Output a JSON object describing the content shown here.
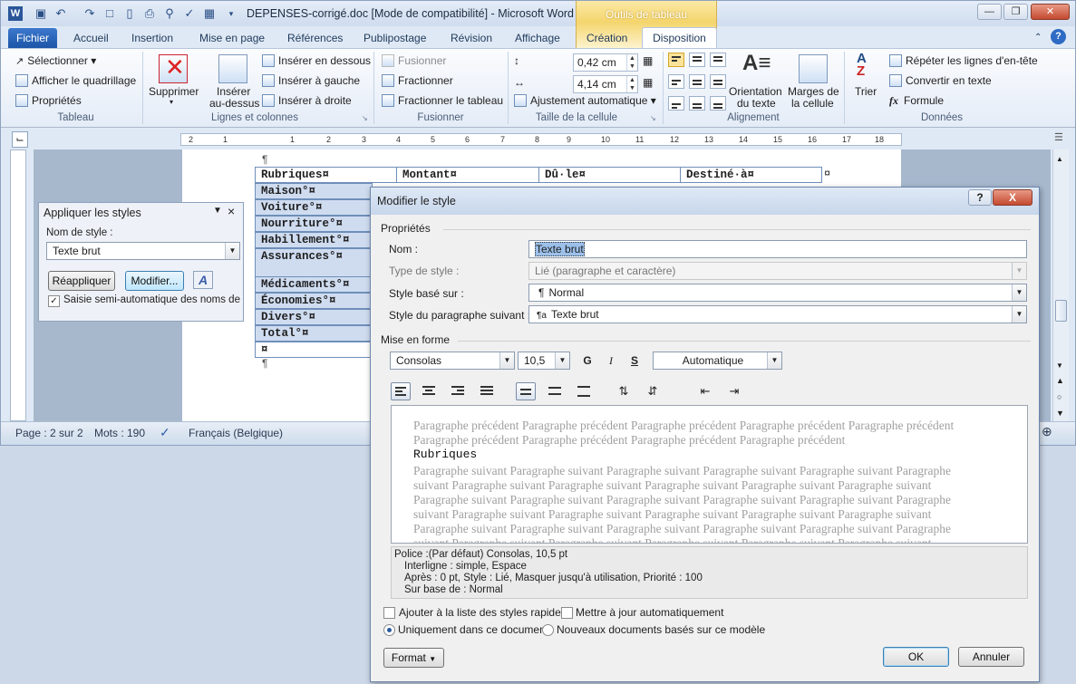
{
  "window": {
    "title": "DEPENSES-corrigé.doc [Mode de compatibilité] - Microsoft Word",
    "context_tab": "Outils de tableau"
  },
  "tabs": [
    "Fichier",
    "Accueil",
    "Insertion",
    "Mise en page",
    "Références",
    "Publipostage",
    "Révision",
    "Affichage",
    "Création",
    "Disposition"
  ],
  "ribbon": {
    "tableau": {
      "label": "Tableau",
      "select": "Sélectionner",
      "grid": "Afficher le quadrillage",
      "props": "Propriétés"
    },
    "lignes": {
      "label": "Lignes et colonnes",
      "delete": "Supprimer",
      "insert_above_1": "Insérer",
      "insert_above_2": "au-dessus",
      "below": "Insérer en dessous",
      "left": "Insérer à gauche",
      "right": "Insérer à droite"
    },
    "fusion": {
      "label": "Fusionner",
      "merge": "Fusionner",
      "split": "Fractionner",
      "split_table": "Fractionner le tableau"
    },
    "taille": {
      "label": "Taille de la cellule",
      "height": "0,42 cm",
      "width": "4,14 cm",
      "autofit": "Ajustement automatique"
    },
    "align": {
      "label": "Alignement",
      "orientation_1": "Orientation",
      "orientation_2": "du texte",
      "margins_1": "Marges de",
      "margins_2": "la cellule"
    },
    "donnees": {
      "label": "Données",
      "sort": "Trier",
      "repeat": "Répéter les lignes d'en-tête",
      "convert": "Convertir en texte",
      "formula": "Formule"
    }
  },
  "ruler": [
    "2",
    "1",
    "1",
    "2",
    "3",
    "4",
    "5",
    "6",
    "7",
    "8",
    "9",
    "10",
    "11",
    "12",
    "13",
    "14",
    "15",
    "16",
    "17",
    "18"
  ],
  "table": {
    "header": [
      "Rubriques¤",
      "Montant¤",
      "Dû·le¤",
      "Destiné·à¤"
    ],
    "rows": [
      "Maison°¤",
      "Voiture°¤",
      "Nourriture°¤",
      "Habillement°¤",
      "Assurances°¤",
      "Médicaments°¤",
      "Économies°¤",
      "Divers°¤",
      "Total°¤",
      "¤"
    ],
    "para_mark": "¶",
    "end_mark": "¤"
  },
  "status": {
    "page": "Page : 2 sur 2",
    "words": "Mots : 190",
    "lang": "Français (Belgique)"
  },
  "apply_styles": {
    "title": "Appliquer les styles",
    "label": "Nom de style :",
    "value": "Texte brut",
    "reapply": "Réappliquer",
    "modify": "Modifier...",
    "auto": "Saisie semi-automatique des noms de styl"
  },
  "dialog": {
    "title": "Modifier le style",
    "props_section": "Propriétés",
    "name_label": "Nom :",
    "name_value": "Texte brut",
    "type_label": "Type de style :",
    "type_value": "Lié (paragraphe et caractère)",
    "based_label": "Style basé sur :",
    "based_value": "Normal",
    "next_label": "Style du paragraphe suivant :",
    "next_value": "Texte brut",
    "format_section": "Mise en forme",
    "font": "Consolas",
    "size": "10,5",
    "bold": "G",
    "italic": "I",
    "underline": "S",
    "color": "Automatique",
    "preview": {
      "prev1": "Paragraphe précédent Paragraphe précédent Paragraphe précédent Paragraphe précédent Paragraphe précédent",
      "prev2": "Paragraphe précédent Paragraphe précédent Paragraphe précédent Paragraphe précédent",
      "sample": "Rubriques",
      "next": [
        "Paragraphe suivant Paragraphe suivant Paragraphe suivant Paragraphe suivant Paragraphe suivant Paragraphe",
        "suivant Paragraphe suivant Paragraphe suivant Paragraphe suivant Paragraphe suivant Paragraphe suivant",
        "Paragraphe suivant Paragraphe suivant Paragraphe suivant Paragraphe suivant Paragraphe suivant Paragraphe",
        "suivant Paragraphe suivant Paragraphe suivant Paragraphe suivant Paragraphe suivant Paragraphe suivant",
        "Paragraphe suivant Paragraphe suivant Paragraphe suivant Paragraphe suivant Paragraphe suivant Paragraphe",
        "suivant Paragraphe suivant Paragraphe suivant Paragraphe suivant Paragraphe suivant Paragraphe suivant"
      ]
    },
    "desc": {
      "line1": "Police :(Par défaut) Consolas, 10,5 pt",
      "line2": "Interligne : simple, Espace",
      "line3": "Après : 0 pt, Style : Lié, Masquer jusqu'à utilisation, Priorité : 100",
      "line4": "Sur base de : Normal"
    },
    "add_quick": "Ajouter à la liste des styles rapides",
    "auto_update": "Mettre à jour automatiquement",
    "only_doc": "Uniquement dans ce document",
    "new_docs": "Nouveaux documents basés sur ce modèle",
    "format_btn": "Format",
    "ok": "OK",
    "cancel": "Annuler",
    "help": "?",
    "close": "X"
  }
}
